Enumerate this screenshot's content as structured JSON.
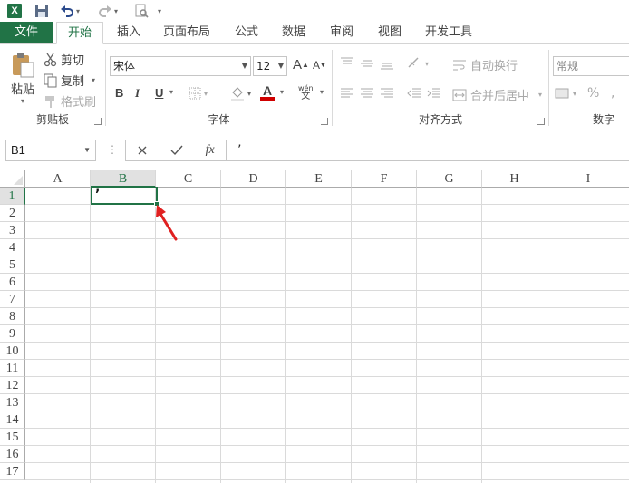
{
  "quick_access": {
    "logo_letter": "X",
    "undo_caret": "▾",
    "redo_caret": "▾",
    "customize_caret": "▾"
  },
  "tabs": {
    "file": "文件",
    "home": "开始",
    "insert": "插入",
    "page_layout": "页面布局",
    "formulas": "公式",
    "data": "数据",
    "review": "审阅",
    "view": "视图",
    "developer": "开发工具"
  },
  "clipboard": {
    "paste": "粘贴",
    "cut": "剪切",
    "copy": "复制",
    "format_painter": "格式刷",
    "label": "剪贴板"
  },
  "font": {
    "font_name": "宋体",
    "font_size": "12",
    "bold": "B",
    "italic": "I",
    "underline": "U",
    "phonetic": "wén",
    "phonetic_sub": "文",
    "font_color_letter": "A",
    "label": "字体"
  },
  "alignment": {
    "wrap_text": "自动换行",
    "merge_center": "合并后居中",
    "label": "对齐方式"
  },
  "number": {
    "format": "常规",
    "percent": "%",
    "label": "数字"
  },
  "formula_bar": {
    "name_box": "B1",
    "fx": "fx",
    "content": "’"
  },
  "sheet": {
    "columns": [
      "A",
      "B",
      "C",
      "D",
      "E",
      "F",
      "G",
      "H",
      "I"
    ],
    "rows": [
      "1",
      "2",
      "3",
      "4",
      "5",
      "6",
      "7",
      "8",
      "9",
      "10",
      "11",
      "12",
      "13",
      "14",
      "15",
      "16",
      "17"
    ],
    "selected_column": "B",
    "selected_row": "1",
    "active_cell_value": "’"
  },
  "colors": {
    "accent": "#217346",
    "font_color": "#d00000",
    "arrow": "#e02020"
  }
}
